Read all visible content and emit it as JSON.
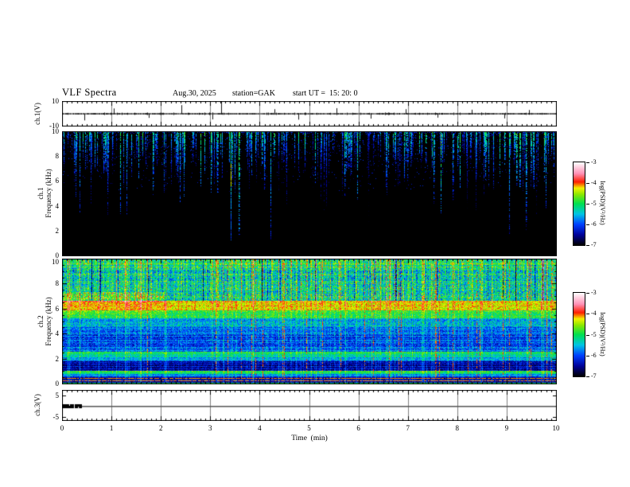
{
  "title": "VLF Spectra",
  "header": {
    "date": "Aug.30, 2025",
    "station": "station=GAK",
    "start_ut": "start UT =  15: 20: 0"
  },
  "x_axis": {
    "label": "Time  (min)",
    "min": 0,
    "max": 10,
    "major_ticks": [
      0,
      1,
      2,
      3,
      4,
      5,
      6,
      7,
      8,
      9,
      10
    ],
    "minor_step": 0.1
  },
  "panels": {
    "ch1_wave": {
      "ylabel": "ch.1(V)",
      "y_range": [
        -10,
        10
      ],
      "yticks": [
        {
          "v": 10,
          "label": "10"
        },
        {
          "v": -10,
          "label": "-10"
        }
      ]
    },
    "ch1_spec": {
      "ylabel_lines": [
        "ch.1",
        "Frequency  (kHz)"
      ],
      "y_range": [
        0,
        10
      ],
      "yticks": [
        0,
        2,
        4,
        6,
        8,
        10
      ],
      "y_minor_step": 0.5
    },
    "ch2_spec": {
      "ylabel_lines": [
        "ch.2",
        "Frequency  (kHz)"
      ],
      "y_range": [
        0,
        10
      ],
      "yticks": [
        0,
        2,
        4,
        6,
        8,
        10
      ],
      "y_minor_step": 0.5
    },
    "ch3_wave": {
      "ylabel": "ch.3(V)",
      "y_range": [
        -6.6,
        7.6
      ],
      "yticks": [
        {
          "v": 5,
          "label": "5"
        },
        {
          "v": -5,
          "label": "-5"
        }
      ]
    }
  },
  "colorbar": {
    "label": "log(PSD)(V²/Hz)",
    "min": -7,
    "max": -3,
    "ticks": [
      -3,
      -4,
      -5,
      -6,
      -7
    ],
    "stops": [
      {
        "v": -7.0,
        "c": "#000000"
      },
      {
        "v": -6.5,
        "c": "#000199"
      },
      {
        "v": -6.0,
        "c": "#0040ff"
      },
      {
        "v": -5.5,
        "c": "#00c4e4"
      },
      {
        "v": -5.0,
        "c": "#00e050"
      },
      {
        "v": -4.55,
        "c": "#8ce800"
      },
      {
        "v": -4.25,
        "c": "#f2f200"
      },
      {
        "v": -3.95,
        "c": "#ff1e00"
      },
      {
        "v": -3.55,
        "c": "#ff8fb4"
      },
      {
        "v": -3.0,
        "c": "#ffffff"
      }
    ]
  },
  "chart_data": [
    {
      "name": "ch1_waveform",
      "type": "line",
      "title": "ch.1 raw signal",
      "xlabel": "Time (min)",
      "x_range": [
        0,
        10
      ],
      "ylabel": "ch.1(V)",
      "y_range": [
        -10,
        10
      ],
      "baseline_v": 0,
      "noise_amp_v": 0.7,
      "spikes": [
        {
          "t": 0.45,
          "amp": -2.6
        },
        {
          "t": 1.05,
          "amp": 2.1
        },
        {
          "t": 1.75,
          "amp": -1.6
        },
        {
          "t": 2.42,
          "amp": 3.4
        },
        {
          "t": 3.05,
          "amp": -2.2
        },
        {
          "t": 3.22,
          "amp": 7.2
        },
        {
          "t": 4.3,
          "amp": 1.8
        },
        {
          "t": 4.78,
          "amp": -2.3
        },
        {
          "t": 5.55,
          "amp": 2.2
        },
        {
          "t": 6.25,
          "amp": -1.9
        },
        {
          "t": 6.95,
          "amp": 1.8
        },
        {
          "t": 7.6,
          "amp": -1.5
        },
        {
          "t": 8.3,
          "amp": 1.6
        },
        {
          "t": 8.95,
          "amp": -1.8
        },
        {
          "t": 9.45,
          "amp": 1.5
        }
      ],
      "summary": "near-zero noisy baseline with sparse small impulses, largest near t=3.2 min"
    },
    {
      "name": "ch1_spectrogram",
      "type": "heatmap",
      "title": "ch.1 VLF spectrogram",
      "xlabel": "Time (min)",
      "x_range": [
        0,
        10
      ],
      "ylabel": "Frequency (kHz)",
      "y_range": [
        0,
        10
      ],
      "z_label": "log(PSD)(V²/Hz)",
      "z_range": [
        -7,
        -3
      ],
      "background_level": -7,
      "streaks": {
        "count": 270,
        "level_min": -6.4,
        "level_max": -4.9,
        "green_fraction": 0.12,
        "typical_bottom_khz": [
          4.5,
          8.5
        ]
      },
      "special_streaks": [
        {
          "t": 3.42,
          "depth_frac": 0.87,
          "level": -4.9,
          "hot": true
        },
        {
          "t": 5.35,
          "depth_frac": 0.6,
          "level": -5.8
        },
        {
          "t": 8.2,
          "depth_frac": 0.62,
          "level": -5.9
        }
      ],
      "summary": "black background; vertical sferic streaks descend from 10 kHz, mostly ending between 8 and 4.5 kHz; blue/cyan with scattered green; below ~4 kHz nearly empty"
    },
    {
      "name": "ch2_spectrogram",
      "type": "heatmap",
      "title": "ch.2 VLF spectrogram",
      "xlabel": "Time (min)",
      "x_range": [
        0,
        10
      ],
      "ylabel": "Frequency (kHz)",
      "y_range": [
        0,
        10
      ],
      "z_label": "log(PSD)(V²/Hz)",
      "z_range": [
        -7,
        -3
      ],
      "bands": [
        {
          "f": [
            9.35,
            10.0
          ],
          "level": -5.1,
          "var": 0.55
        },
        {
          "f": [
            6.65,
            9.35
          ],
          "level": -5.3,
          "var": 0.65
        },
        {
          "f": [
            5.9,
            6.65
          ],
          "level": -4.35,
          "var": 0.3
        },
        {
          "f": [
            5.25,
            5.9
          ],
          "level": -5.0,
          "var": 0.4
        },
        {
          "f": [
            4.55,
            5.25
          ],
          "level": -5.5,
          "var": 0.45
        },
        {
          "f": [
            2.6,
            4.55
          ],
          "level": -5.95,
          "var": 0.4
        },
        {
          "f": [
            2.15,
            2.6
          ],
          "level": -5.15,
          "var": 0.35
        },
        {
          "f": [
            1.8,
            2.15
          ],
          "level": -5.75,
          "var": 0.35
        },
        {
          "f": [
            1.05,
            1.8
          ],
          "level": -6.45,
          "var": 0.3
        },
        {
          "f": [
            0.8,
            1.05
          ],
          "level": -5.1,
          "var": 0.3
        },
        {
          "f": [
            0.55,
            0.8
          ],
          "level": -5.9,
          "var": 0.3
        },
        {
          "f": [
            0.1,
            0.55
          ],
          "level": -6.55,
          "var": 0.25
        },
        {
          "f": [
            0.0,
            0.1
          ],
          "level": -5.3,
          "var": 0.3
        }
      ],
      "red_lines_khz": [
        0.25,
        0.45
      ],
      "green_streaks": {
        "count": 240,
        "max_boost": 1.1
      },
      "dark_columns": 26,
      "red_verticals": 30,
      "hot_spots": {
        "count": 85,
        "f_center": 6.25
      },
      "left_zones": [
        {
          "t_max": 2.05,
          "f": [
            6.6,
            7.35
          ],
          "boost": 0.5
        },
        {
          "t_max": 2.1,
          "f": [
            5.5,
            6.6
          ],
          "boost": 0.15
        }
      ],
      "summary": "broadband noisy spectrogram: bright yellow-green band near 6-6.6 kHz with red flecks, green/cyan streaky texture above 6.6 kHz, blue mottled 2.6-4.5 kHz, dark band 1.1-1.8 kHz, green line ~0.9 kHz, dark bottom with two dark-red lines near 0.25 and 0.45 kHz, many vertical green sferic lines and thin red vertical interference lines"
    },
    {
      "name": "ch3_waveform",
      "type": "line",
      "title": "ch.3 raw signal",
      "xlabel": "Time (min)",
      "x_range": [
        0,
        10
      ],
      "ylabel": "ch.3(V)",
      "y_range": [
        -5,
        5
      ],
      "baseline_v": 0,
      "bar_segment": {
        "t_start": 0.02,
        "t_end": 0.4
      },
      "summary": "flat 0 V line for the whole record with a thick dark saturated segment during the first ~0.4 min"
    }
  ]
}
